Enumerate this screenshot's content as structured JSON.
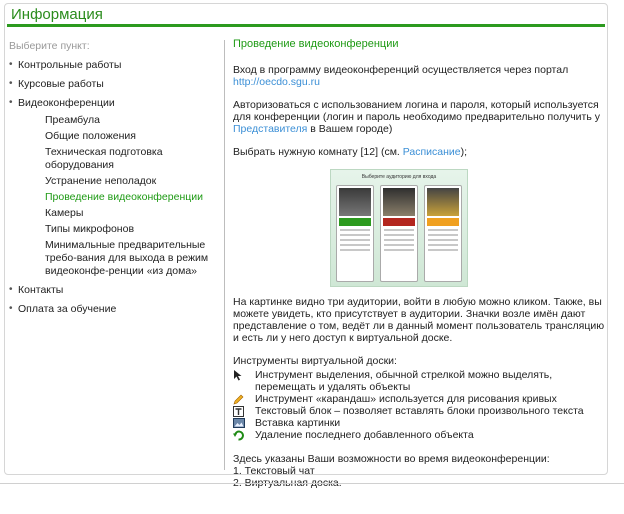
{
  "header": {
    "title": "Информация"
  },
  "sidebar": {
    "prompt": "Выберите пункт:",
    "items": [
      {
        "label": "Контрольные работы"
      },
      {
        "label": "Курсовые работы"
      },
      {
        "label": "Видеоконференции"
      },
      {
        "label": "Контакты"
      },
      {
        "label": "Оплата за обучение"
      }
    ],
    "subitems": [
      {
        "label": "Преамбула"
      },
      {
        "label": "Общие положения"
      },
      {
        "label": "Техническая подготовка оборудования"
      },
      {
        "label": "Устранение неполадок"
      },
      {
        "label": "Проведение видеоконференции"
      },
      {
        "label": "Камеры"
      },
      {
        "label": "Типы микрофонов"
      },
      {
        "label": "Минимальные предварительные требо-вания для выхода в режим видеоконфе-ренции «из дома»"
      }
    ],
    "active_subitem": 4
  },
  "content": {
    "title": "Проведение видеоконференции",
    "p1_text": "Вход в программу видеоконференций осуществляется через портал",
    "p1_link": "http://oecdo.sgu.ru",
    "p2_text": "Авторизоваться с использованием логина и пароля, который используется для конференции (логин и пароль необходимо предварительно получить у",
    "p2_link": "Представителя",
    "p2_tail": "в Вашем городе)",
    "p3_text": "Выбрать нужную комнату [12] (см.",
    "p3_link": "Расписание",
    "p3_tail": ");",
    "figure_title": "Выберите аудиторию для входа",
    "p4_text": "На картинке видно три аудитории, войти в любую можно кликом. Также, вы можете увидеть, кто присутствует в аудитории. Значки возле имён дают представление о том, ведёт ли в данный момент пользователь трансляцию и есть ли у него доступ к виртуальной доске.",
    "tools_heading": "Инструменты виртуальной доски:",
    "tools": [
      {
        "icon": "cursor-arrow-icon",
        "text": "Инструмент выделения, обычной стрелкой можно выделять, перемещать и удалять объекты"
      },
      {
        "icon": "pencil-icon",
        "text": "Инструмент «карандаш» используется для рисования кривых"
      },
      {
        "icon": "text-block-icon",
        "text": "Текстовый блок – позволяет вставлять блоки произвольного текста"
      },
      {
        "icon": "insert-image-icon",
        "text": "Вставка картинки"
      },
      {
        "icon": "undo-icon",
        "text": "Удаление последнего добавленного объекта"
      }
    ],
    "caps_heading": "Здесь указаны Ваши возможности во время видеоконференции:",
    "caps": [
      "1. Текстовый чат",
      "2. Виртуальная доска."
    ]
  },
  "colors": {
    "accent_green": "#2c9a1f",
    "link_blue": "#3b8fd6",
    "active_green": "#1e9a14"
  }
}
